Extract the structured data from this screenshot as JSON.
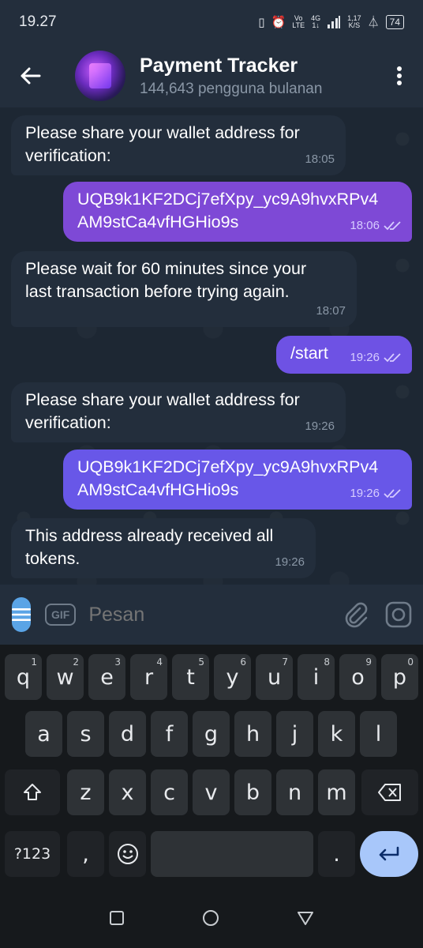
{
  "status_bar": {
    "time": "19.27",
    "network_top": "Vo",
    "network_bottom": "LTE",
    "gen_top": "4G",
    "gen_bottom": "1↓",
    "speed_top": "1,17",
    "speed_bottom": "K/S",
    "battery": "74"
  },
  "header": {
    "title": "Payment Tracker",
    "subtitle": "144,643 pengguna bulanan"
  },
  "messages": [
    {
      "dir": "in",
      "text": "Please share your wallet address for verification:",
      "time": "18:05"
    },
    {
      "dir": "out",
      "text": "UQB9k1KF2DCj7efXpy_yc9A9hvxRPv4AM9stCa4vfHGHio9s",
      "line1": "UQB9k1KF2DCj7efXpy_yc9A9hvxRPv4",
      "line2": "AM9stCa4vfHGHio9s",
      "time": "18:06"
    },
    {
      "dir": "in",
      "text": "Please wait for 60 minutes since your last transaction before trying again.",
      "line1": "Please wait for 60 minutes since your",
      "line2": "last transaction before trying again.",
      "time": "18:07"
    },
    {
      "dir": "out",
      "text": "/start",
      "time": "19:26"
    },
    {
      "dir": "in",
      "text": "Please share your wallet address for verification:",
      "line1": "Please share your wallet address for",
      "line2": "verification:",
      "time": "19:26"
    },
    {
      "dir": "out",
      "text": "UQB9k1KF2DCj7efXpy_yc9A9hvxRPv4AM9stCa4vfHGHio9s",
      "line1": "UQB9k1KF2DCj7efXpy_yc9A9hvxRPv4",
      "line2": "AM9stCa4vfHGHio9s",
      "time": "19:26"
    },
    {
      "dir": "in",
      "text": "This address already received all tokens.",
      "line1": "This address already received all",
      "line2": "tokens.",
      "time": "19:26"
    }
  ],
  "msg0": {
    "line1": "Please share your wallet address for",
    "line2": "verification:"
  },
  "input": {
    "placeholder": "Pesan",
    "gif_label": "GIF"
  },
  "keyboard": {
    "row1": [
      {
        "k": "q",
        "n": "1"
      },
      {
        "k": "w",
        "n": "2"
      },
      {
        "k": "e",
        "n": "3"
      },
      {
        "k": "r",
        "n": "4"
      },
      {
        "k": "t",
        "n": "5"
      },
      {
        "k": "y",
        "n": "6"
      },
      {
        "k": "u",
        "n": "7"
      },
      {
        "k": "i",
        "n": "8"
      },
      {
        "k": "o",
        "n": "9"
      },
      {
        "k": "p",
        "n": "0"
      }
    ],
    "row2": [
      "a",
      "s",
      "d",
      "f",
      "g",
      "h",
      "j",
      "k",
      "l"
    ],
    "row3": [
      "z",
      "x",
      "c",
      "v",
      "b",
      "n",
      "m"
    ],
    "symbols_label": "?123",
    "comma": ",",
    "period": "."
  },
  "colors": {
    "accent": "#5aa4e6",
    "bubble_out": "#7e49d6",
    "bubble_in": "#232e3c",
    "background": "#1d2733"
  }
}
